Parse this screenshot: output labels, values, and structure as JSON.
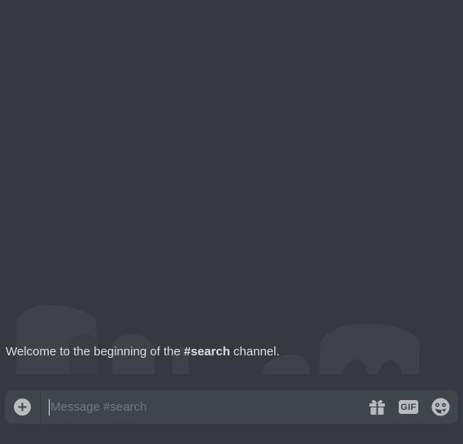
{
  "welcome": {
    "prefix": "Welcome to the beginning of the ",
    "channel": "#search",
    "suffix": " channel."
  },
  "composer": {
    "placeholder": "Message #search",
    "value": "",
    "gif_label": "GIF",
    "icons": {
      "attach": "plus-circle-icon",
      "gift": "gift-icon",
      "gif": "gif-icon",
      "emoji": "emoji-icon"
    }
  },
  "colors": {
    "background": "#36393f",
    "composer": "#40444b",
    "text": "#dcddde",
    "placeholder": "#72767d",
    "icon": "#b9bbbe"
  }
}
